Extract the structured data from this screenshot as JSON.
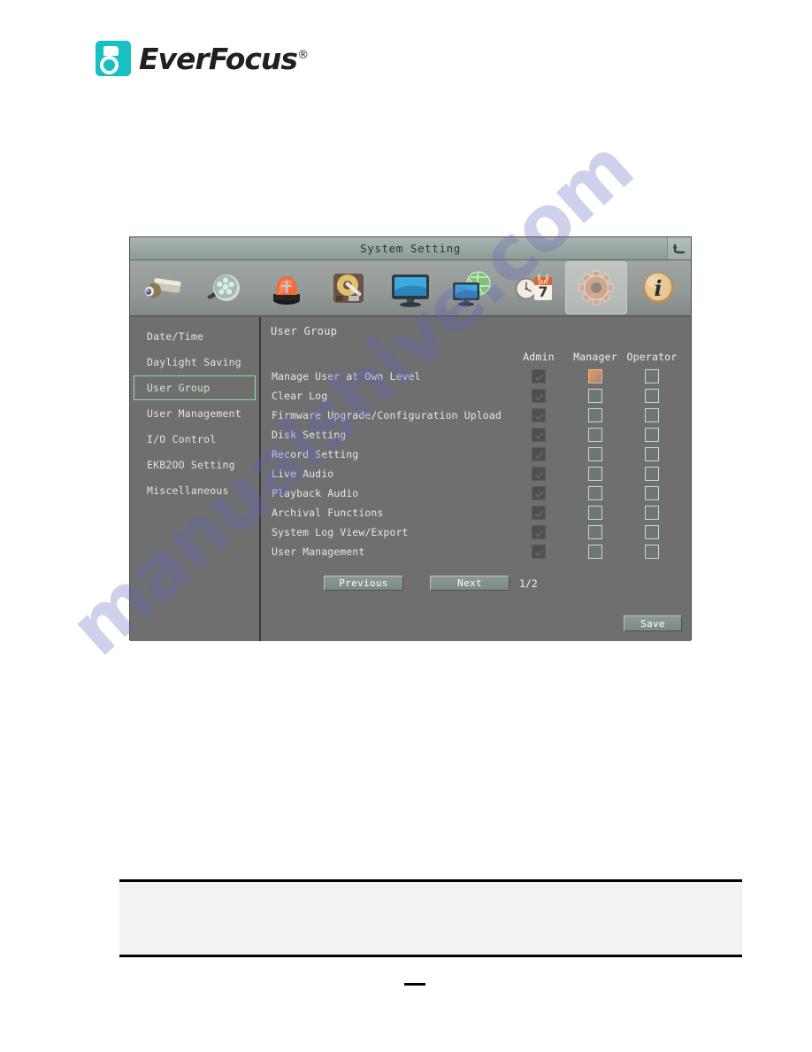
{
  "brand": {
    "name": "EverFocus",
    "registered_mark": "®",
    "logo_color": "#18c0c2",
    "icon": "everfocus-logo-icon"
  },
  "watermark": {
    "text": "manualshive.com",
    "color": "#6062be"
  },
  "dialog": {
    "title": "System Setting",
    "back_icon": "back-arrow-icon",
    "toolbar": {
      "items": [
        {
          "name": "camera-icon",
          "label": "Camera",
          "selected": false
        },
        {
          "name": "film-reel-icon",
          "label": "Record",
          "selected": false
        },
        {
          "name": "alarm-light-icon",
          "label": "Alarm",
          "selected": false
        },
        {
          "name": "hard-disk-icon",
          "label": "Disk",
          "selected": false
        },
        {
          "name": "monitor-icon",
          "label": "Display",
          "selected": false
        },
        {
          "name": "network-globe-icon",
          "label": "Network",
          "selected": false
        },
        {
          "name": "clock-calendar-icon",
          "label": "Schedule",
          "selected": false
        },
        {
          "name": "gear-icon",
          "label": "System",
          "selected": true
        },
        {
          "name": "info-icon",
          "label": "Information",
          "selected": false
        }
      ],
      "calendar_month": "JAN",
      "calendar_day": "7"
    },
    "sidebar": {
      "items": [
        {
          "label": "Date/Time",
          "selected": false
        },
        {
          "label": "Daylight Saving",
          "selected": false
        },
        {
          "label": "User Group",
          "selected": true
        },
        {
          "label": "User Management",
          "selected": false
        },
        {
          "label": "I/O Control",
          "selected": false
        },
        {
          "label": "EKB2OO Setting",
          "selected": false
        },
        {
          "label": "Miscellaneous",
          "selected": false
        }
      ],
      "selected_border_color": "#8fe09a"
    },
    "content": {
      "title": "User Group",
      "columns": [
        "Admin",
        "Manager",
        "Operator"
      ],
      "rows": [
        {
          "label": "Manage User at Own Level",
          "admin": "checked-disabled",
          "manager": "focused",
          "operator": "unchecked"
        },
        {
          "label": "Clear Log",
          "admin": "checked-disabled",
          "manager": "unchecked",
          "operator": "unchecked"
        },
        {
          "label": "Firmware Upgrade/Configuration Upload",
          "admin": "checked-disabled",
          "manager": "unchecked",
          "operator": "unchecked"
        },
        {
          "label": "Disk Setting",
          "admin": "checked-disabled",
          "manager": "unchecked",
          "operator": "unchecked"
        },
        {
          "label": "Record Setting",
          "admin": "checked-disabled",
          "manager": "unchecked",
          "operator": "unchecked"
        },
        {
          "label": "Live Audio",
          "admin": "checked-disabled",
          "manager": "unchecked",
          "operator": "unchecked"
        },
        {
          "label": "Playback Audio",
          "admin": "checked-disabled",
          "manager": "unchecked",
          "operator": "unchecked"
        },
        {
          "label": "Archival Functions",
          "admin": "checked-disabled",
          "manager": "unchecked",
          "operator": "unchecked"
        },
        {
          "label": "System Log View/Export",
          "admin": "checked-disabled",
          "manager": "unchecked",
          "operator": "unchecked"
        },
        {
          "label": "User Management",
          "admin": "checked-disabled",
          "manager": "unchecked",
          "operator": "unchecked"
        }
      ],
      "previous_label": "Previous",
      "next_label": "Next",
      "page_indicator": "1/2",
      "save_label": "Save"
    }
  }
}
